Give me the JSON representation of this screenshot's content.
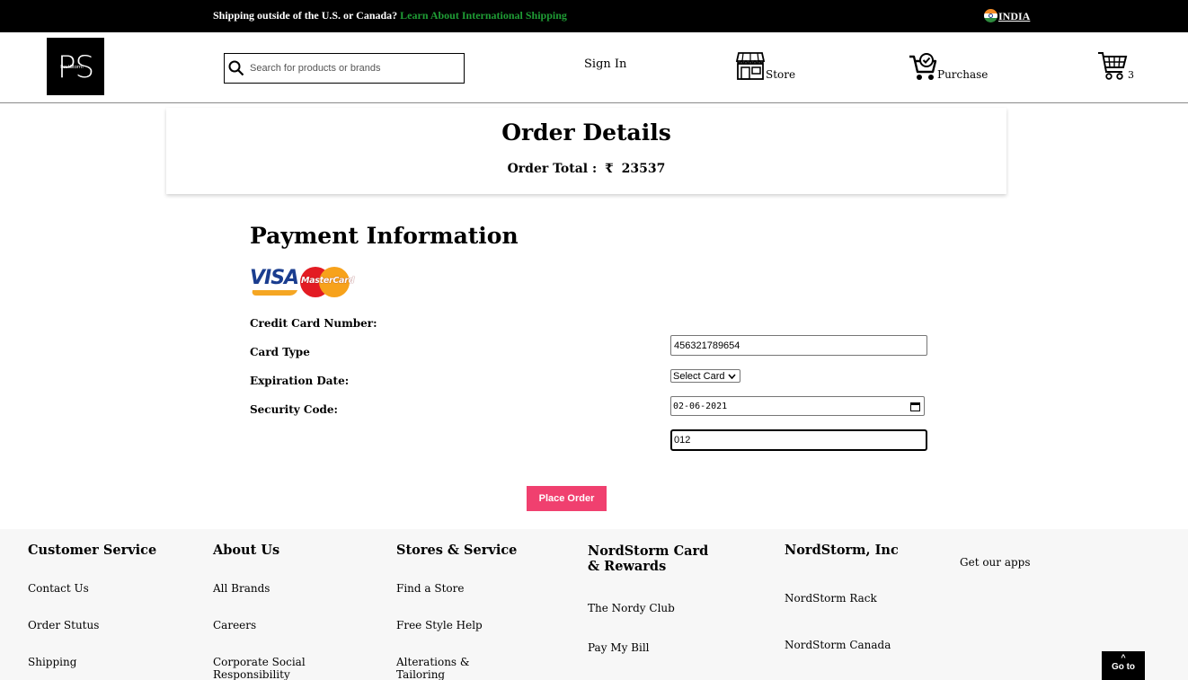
{
  "banner": {
    "shipping_text": "Shipping outside of the U.S. or Canada?",
    "shipping_link": "Learn About International Shipping",
    "country": "INDIA"
  },
  "header": {
    "logo_text": "PS",
    "logo_subtext": "PostStorm",
    "search_placeholder": "Search for products or brands",
    "sign_in": "Sign In",
    "store_label": "Store",
    "purchase_label": "Purchase",
    "cart_count": "3"
  },
  "order": {
    "title": "Order Details",
    "total_label": "Order Total :",
    "currency": "₹",
    "total_value": "23537"
  },
  "payment": {
    "title": "Payment Information",
    "card_logos": [
      "VISA",
      "MasterCard"
    ],
    "labels": {
      "card_number": "Credit Card Number:",
      "card_type": "Card Type",
      "expiration": "Expiration Date:",
      "security": "Security Code:"
    },
    "values": {
      "card_number": "456321789654",
      "card_type": "Select Card",
      "expiration": "02-06-2021",
      "security": "012"
    },
    "submit": "Place Order"
  },
  "footer": {
    "columns": [
      {
        "heading": "Customer Service",
        "links": [
          "Contact Us",
          "Order Stutus",
          "Shipping"
        ]
      },
      {
        "heading": "About Us",
        "links": [
          "All Brands",
          "Careers",
          "Corporate Social Responsibility"
        ]
      },
      {
        "heading": "Stores & Service",
        "links": [
          "Find a Store",
          "Free Style Help",
          "Alterations & Tailoring"
        ]
      },
      {
        "heading": "NordStorm Card & Rewards",
        "links": [
          "The Nordy Club",
          "Pay My Bill"
        ]
      },
      {
        "heading": "NordStorm, Inc",
        "links": [
          "NordStorm Rack",
          "NordStorm Canada"
        ]
      }
    ],
    "apps": "Get our apps",
    "goto_label": "Go to"
  },
  "colors": {
    "banner_bg": "#000000",
    "link_green": "#1f9d35",
    "button_pink": "#f0406f",
    "footer_bg": "#f7f7f7"
  }
}
